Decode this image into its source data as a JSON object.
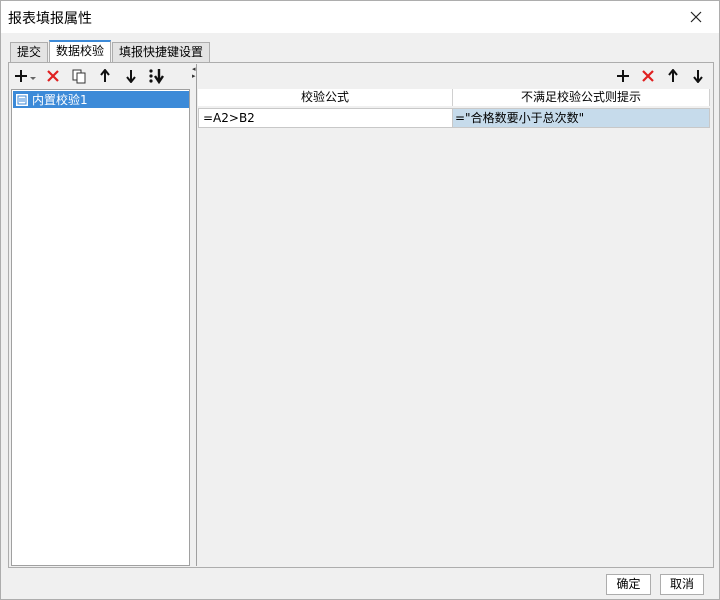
{
  "window": {
    "title": "报表填报属性"
  },
  "tabs": [
    {
      "label": "提交"
    },
    {
      "label": "数据校验"
    },
    {
      "label": "填报快捷键设置"
    }
  ],
  "left_list": {
    "items": [
      {
        "label": "内置校验1"
      }
    ]
  },
  "grid": {
    "columns": [
      "校验公式",
      "不满足校验公式则提示"
    ],
    "rows": [
      {
        "formula": "=A2>B2",
        "message": "=\"合格数要小于总次数\""
      }
    ]
  },
  "footer": {
    "ok_label": "确定",
    "cancel_label": "取消"
  },
  "colors": {
    "accent": "#3c8ad8",
    "delete_red": "#e02020",
    "selected_cell": "#c6dbeb"
  }
}
